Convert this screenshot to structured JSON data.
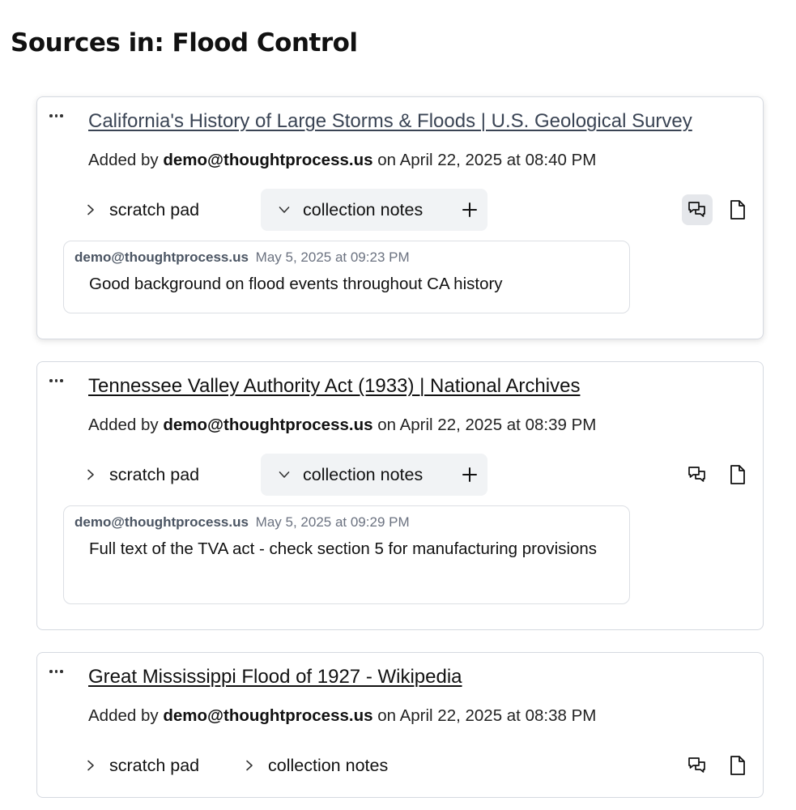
{
  "page_title": "Sources in: Flood Control",
  "sources": [
    {
      "title": "California's History of Large Storms & Floods | U.S. Geological Survey",
      "added_prefix": "Added by",
      "added_by": "demo@thoughtprocess.us",
      "added_suffix": "on April 22, 2025 at 08:40 PM",
      "scratch_label": "scratch pad",
      "collection_label": "collection notes",
      "note": {
        "author": "demo@thoughtprocess.us",
        "date": "May 5, 2025 at 09:23 PM",
        "text": "Good background on flood events throughout CA history"
      }
    },
    {
      "title": "Tennessee Valley Authority Act (1933) | National Archives",
      "added_prefix": "Added by",
      "added_by": "demo@thoughtprocess.us",
      "added_suffix": "on April 22, 2025 at 08:39 PM",
      "scratch_label": "scratch pad",
      "collection_label": "collection notes",
      "note": {
        "author": "demo@thoughtprocess.us",
        "date": "May 5, 2025 at 09:29 PM",
        "text": "Full text of the TVA act - check section 5 for manufacturing provisions"
      }
    },
    {
      "title": "Great Mississippi Flood of 1927 - Wikipedia",
      "added_prefix": "Added by",
      "added_by": "demo@thoughtprocess.us",
      "added_suffix": "on April 22, 2025 at 08:38 PM",
      "scratch_label": "scratch pad",
      "collection_label": "collection notes"
    }
  ]
}
